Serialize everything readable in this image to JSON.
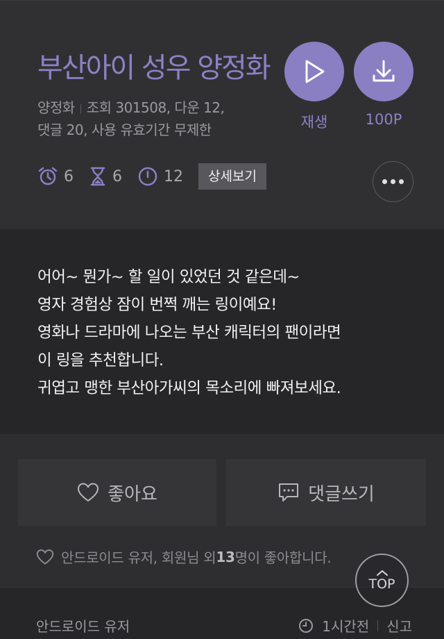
{
  "ring": {
    "title": "부산아이 성우 양정화",
    "artist": "양정화",
    "meta_views": "조회 301508, 다운 12,",
    "meta_line2": "댓글 20, 사용 유효기간 무제한"
  },
  "actions": {
    "play_label": "재생",
    "download_label": "100P",
    "detail_label": "상세보기"
  },
  "stats": {
    "alarm_count": "6",
    "hourglass_count": "6",
    "timer_count": "12"
  },
  "description": "어어~ 뭔가~ 할 일이 있었던 것 같은데~\n영자 경험상 잠이 번쩍 깨는 링이예요!\n영화나 드라마에 나오는 부산 캐릭터의 팬이라면\n이 링을 추천합니다.\n귀엽고 맹한 부산아가씨의 목소리에 빠져보세요.",
  "buttons": {
    "like_label": "좋아요",
    "comment_label": "댓글쓰기"
  },
  "likes": {
    "prefix": "안드로이드 유저, 회원님 외 ",
    "count": "13",
    "suffix": "명이 좋아합니다."
  },
  "top_label": "TOP",
  "comment": {
    "author": "안드로이드 유저",
    "time": "1시간전",
    "report_label": "신고"
  },
  "colors": {
    "accent": "#8b7fc3",
    "background": "#262629",
    "header_bg": "#303033"
  }
}
